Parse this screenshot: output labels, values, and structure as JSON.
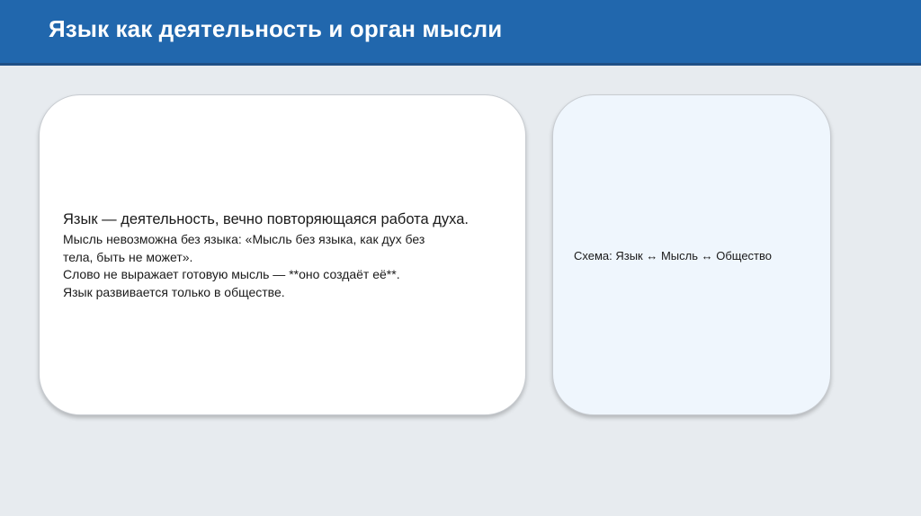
{
  "header": {
    "title": "Язык как деятельность и орган мысли"
  },
  "left_card": {
    "lead": "Язык — деятельность, вечно повторяющаяся работа духа.",
    "lines": [
      "Мысль невозможна без языка: «Мысль без языка, как дух без",
      "тела, быть не может».",
      "Слово не выражает готовую мысль — **оно создаёт её**.",
      "Язык развивается только в обществе."
    ]
  },
  "right_card": {
    "text": "Схема: Язык ↔ Мысль ↔ Общество"
  },
  "colors": {
    "header_bg": "#2167ad",
    "page_bg": "#e7ebef",
    "left_card_bg": "#ffffff",
    "right_card_bg": "#eff6fd"
  }
}
